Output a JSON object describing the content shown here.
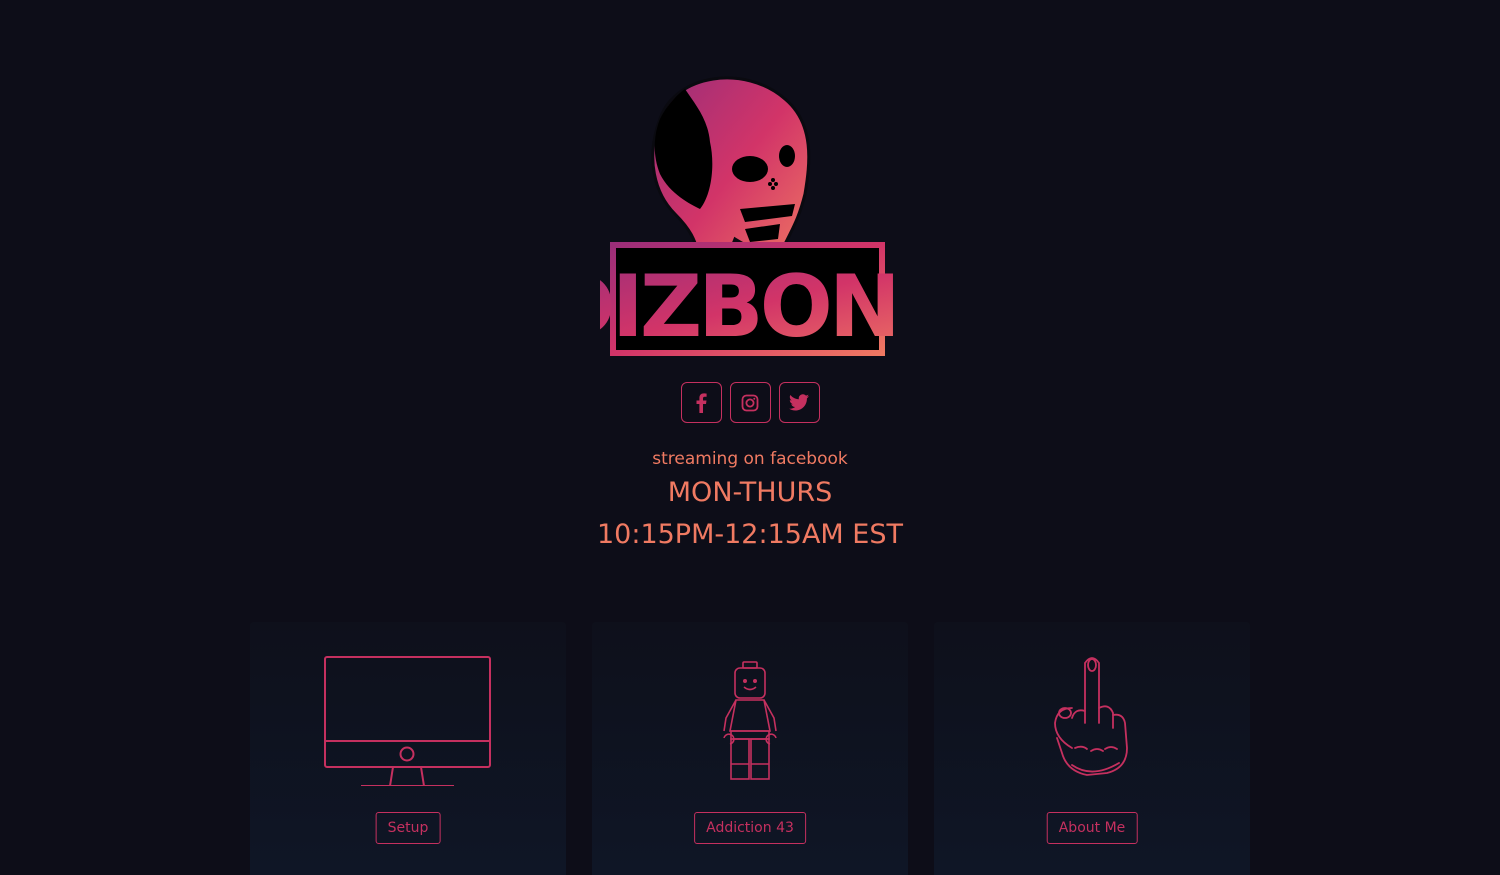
{
  "brand": {
    "name": "DIZBONE",
    "logo_icon": "skull-logo-icon"
  },
  "socials": [
    {
      "name": "facebook",
      "icon": "facebook-icon"
    },
    {
      "name": "instagram",
      "icon": "instagram-icon"
    },
    {
      "name": "twitter",
      "icon": "twitter-icon"
    }
  ],
  "schedule": {
    "label": "streaming on facebook",
    "days": "MON-THURS",
    "hours": "10:15PM-12:15AM EST"
  },
  "cards": [
    {
      "label": "Setup",
      "icon": "imac-monitor-icon"
    },
    {
      "label": "Addiction 43",
      "icon": "lego-minifigure-icon"
    },
    {
      "label": "About Me",
      "icon": "middle-finger-hand-icon"
    }
  ],
  "colors": {
    "background": "#0d0d18",
    "accent_pink": "#c5305f",
    "accent_orange": "#f07a62"
  }
}
